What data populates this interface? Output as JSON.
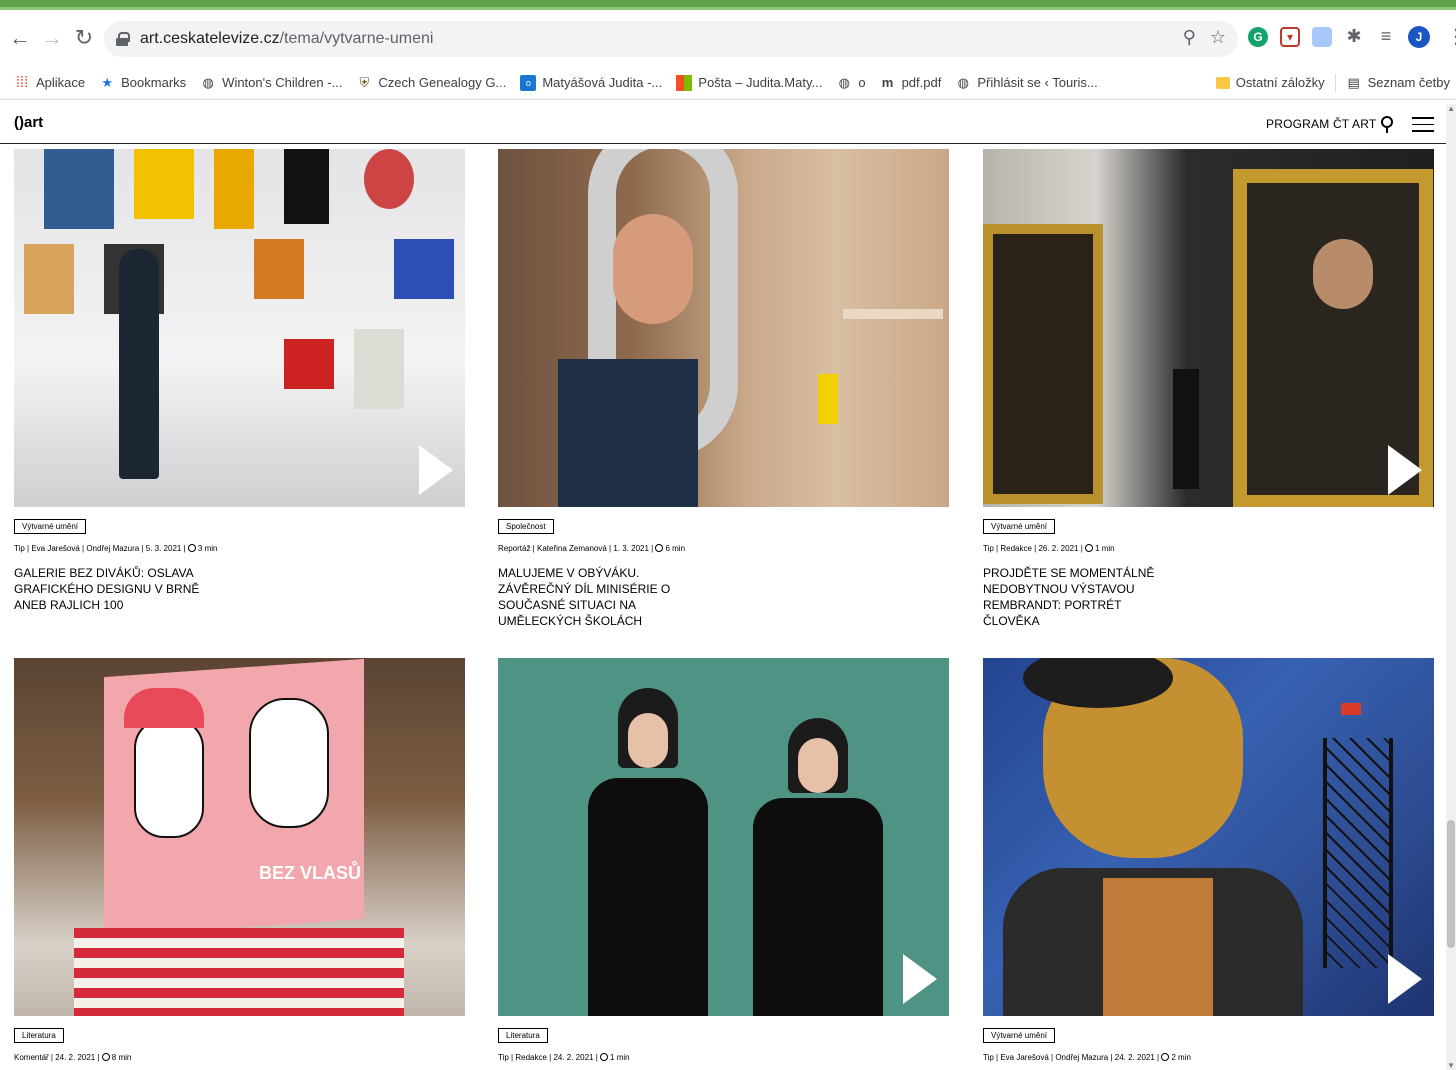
{
  "browser": {
    "url_host": "art.ceskatelevize.cz",
    "url_path": "/tema/vytvarne-umeni",
    "profile_initial": "J",
    "bookmarks": [
      {
        "label": "Aplikace",
        "icon": "apps-icon"
      },
      {
        "label": "Bookmarks",
        "icon": "star-icon"
      },
      {
        "label": "Winton's Children -...",
        "icon": "globe-icon"
      },
      {
        "label": "Czech Genealogy G...",
        "icon": "shield-icon"
      },
      {
        "label": "Matyášová Judita -...",
        "icon": "outlook-icon"
      },
      {
        "label": "Pošta – Judita.Maty...",
        "icon": "microsoft-icon"
      },
      {
        "label": "o",
        "icon": "globe-icon"
      },
      {
        "label": "pdf.pdf",
        "icon": "m-icon"
      },
      {
        "label": "Přihlásit se ‹ Touris...",
        "icon": "wordpress-icon"
      }
    ],
    "other_bookmarks": "Ostatní záložky",
    "reading_list": "Seznam četby"
  },
  "site": {
    "logo": "()art",
    "program_link": "PROGRAM ČT ART"
  },
  "articles": [
    {
      "tag": "Výtvarné umění",
      "meta": "Tip | Eva Jarešová | Ondřej Mazura | 5. 3. 2021 |",
      "read_time": "3 min",
      "title": "GALERIE BEZ DIVÁKŮ: OSLAVA GRAFICKÉHO DESIGNU V BRNĚ ANEB RAJLICH 100",
      "video": true
    },
    {
      "tag": "Společnost",
      "meta": "Reportáž | Kateřina Zemanová | 1. 3. 2021 |",
      "read_time": "6 min",
      "title": "MALUJEME V OBÝVÁKU. ZÁVĚREČNÝ DÍL MINISÉRIE O SOUČASNÉ SITUACI NA UMĚLECKÝCH ŠKOLÁCH",
      "video": false
    },
    {
      "tag": "Výtvarné umění",
      "meta": "Tip | Redakce | 26. 2. 2021 |",
      "read_time": "1 min",
      "title": "PROJDĚTE SE MOMENTÁLNĚ NEDOBYTNOU VÝSTAVOU REMBRANDT: PORTRÉT ČLOVĚKA",
      "video": true
    },
    {
      "tag": "Literatura",
      "meta": "Komentář | 24. 2. 2021 |",
      "read_time": "8 min",
      "title": "",
      "video": false
    },
    {
      "tag": "Literatura",
      "meta": "Tip | Redakce | 24. 2. 2021 |",
      "read_time": "1 min",
      "title": "",
      "video": true
    },
    {
      "tag": "Výtvarné umění",
      "meta": "Tip | Eva Jarešová | Ondřej Mazura | 24. 2. 2021 |",
      "read_time": "2 min",
      "title": "",
      "video": true
    }
  ],
  "book_cover_text": {
    "spine": "BEZ VLASŮ",
    "front": "BEZ VLASŮ"
  }
}
